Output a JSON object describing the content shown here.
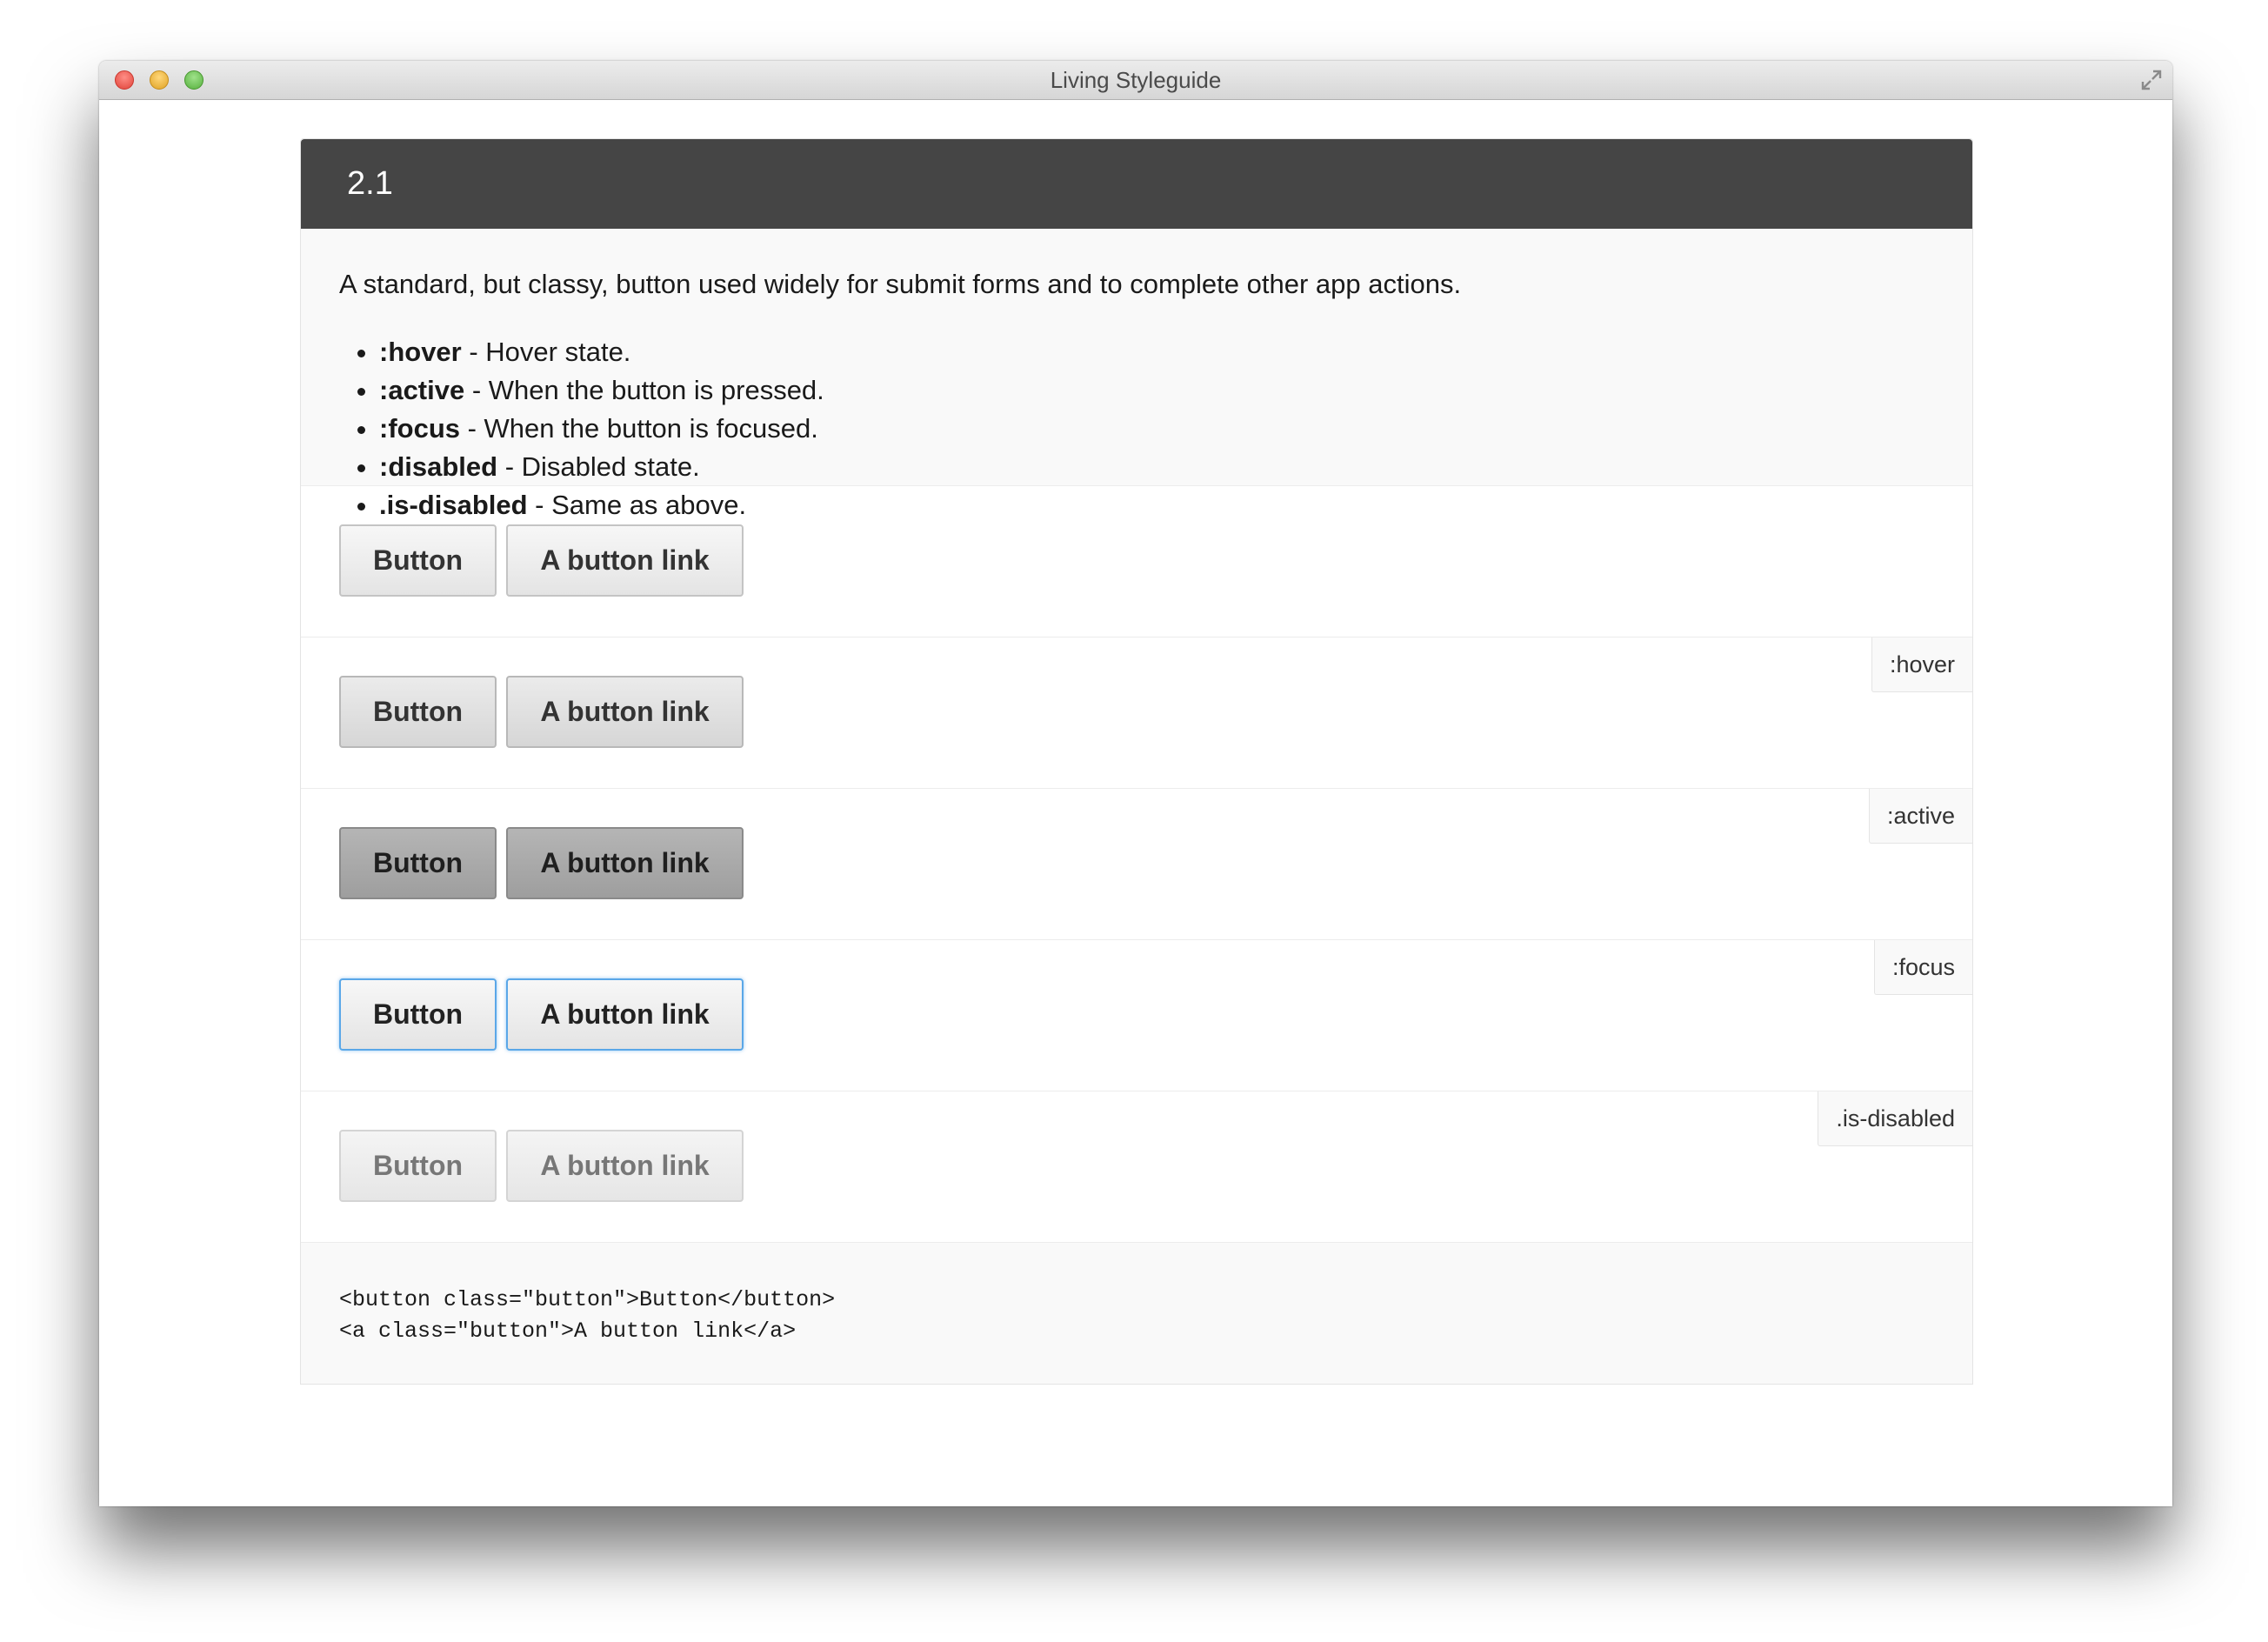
{
  "window": {
    "title": "Living Styleguide"
  },
  "section": {
    "number": "2.1",
    "description": "A standard, but classy, button used widely for submit forms and to complete other app actions.",
    "modifiers": [
      {
        "name": ":hover",
        "text": " - Hover state."
      },
      {
        "name": ":active",
        "text": " - When the button is pressed."
      },
      {
        "name": ":focus",
        "text": " - When the button is focused."
      },
      {
        "name": ":disabled",
        "text": " - Disabled state."
      },
      {
        "name": ".is-disabled",
        "text": " - Same as above."
      }
    ]
  },
  "examples": [
    {
      "state_label": "",
      "button_label": "Button",
      "link_label": "A button link"
    },
    {
      "state_label": ":hover",
      "button_label": "Button",
      "link_label": "A button link"
    },
    {
      "state_label": ":active",
      "button_label": "Button",
      "link_label": "A button link"
    },
    {
      "state_label": ":focus",
      "button_label": "Button",
      "link_label": "A button link"
    },
    {
      "state_label": ".is-disabled",
      "button_label": "Button",
      "link_label": "A button link"
    }
  ],
  "code": {
    "lines": [
      "<button class=\"button\">Button</button>",
      "<a class=\"button\">A button link</a>"
    ]
  },
  "colors": {
    "header_bg": "#454545",
    "focus_border": "#5aa7e8",
    "active_bg": "#a9a9a9"
  }
}
